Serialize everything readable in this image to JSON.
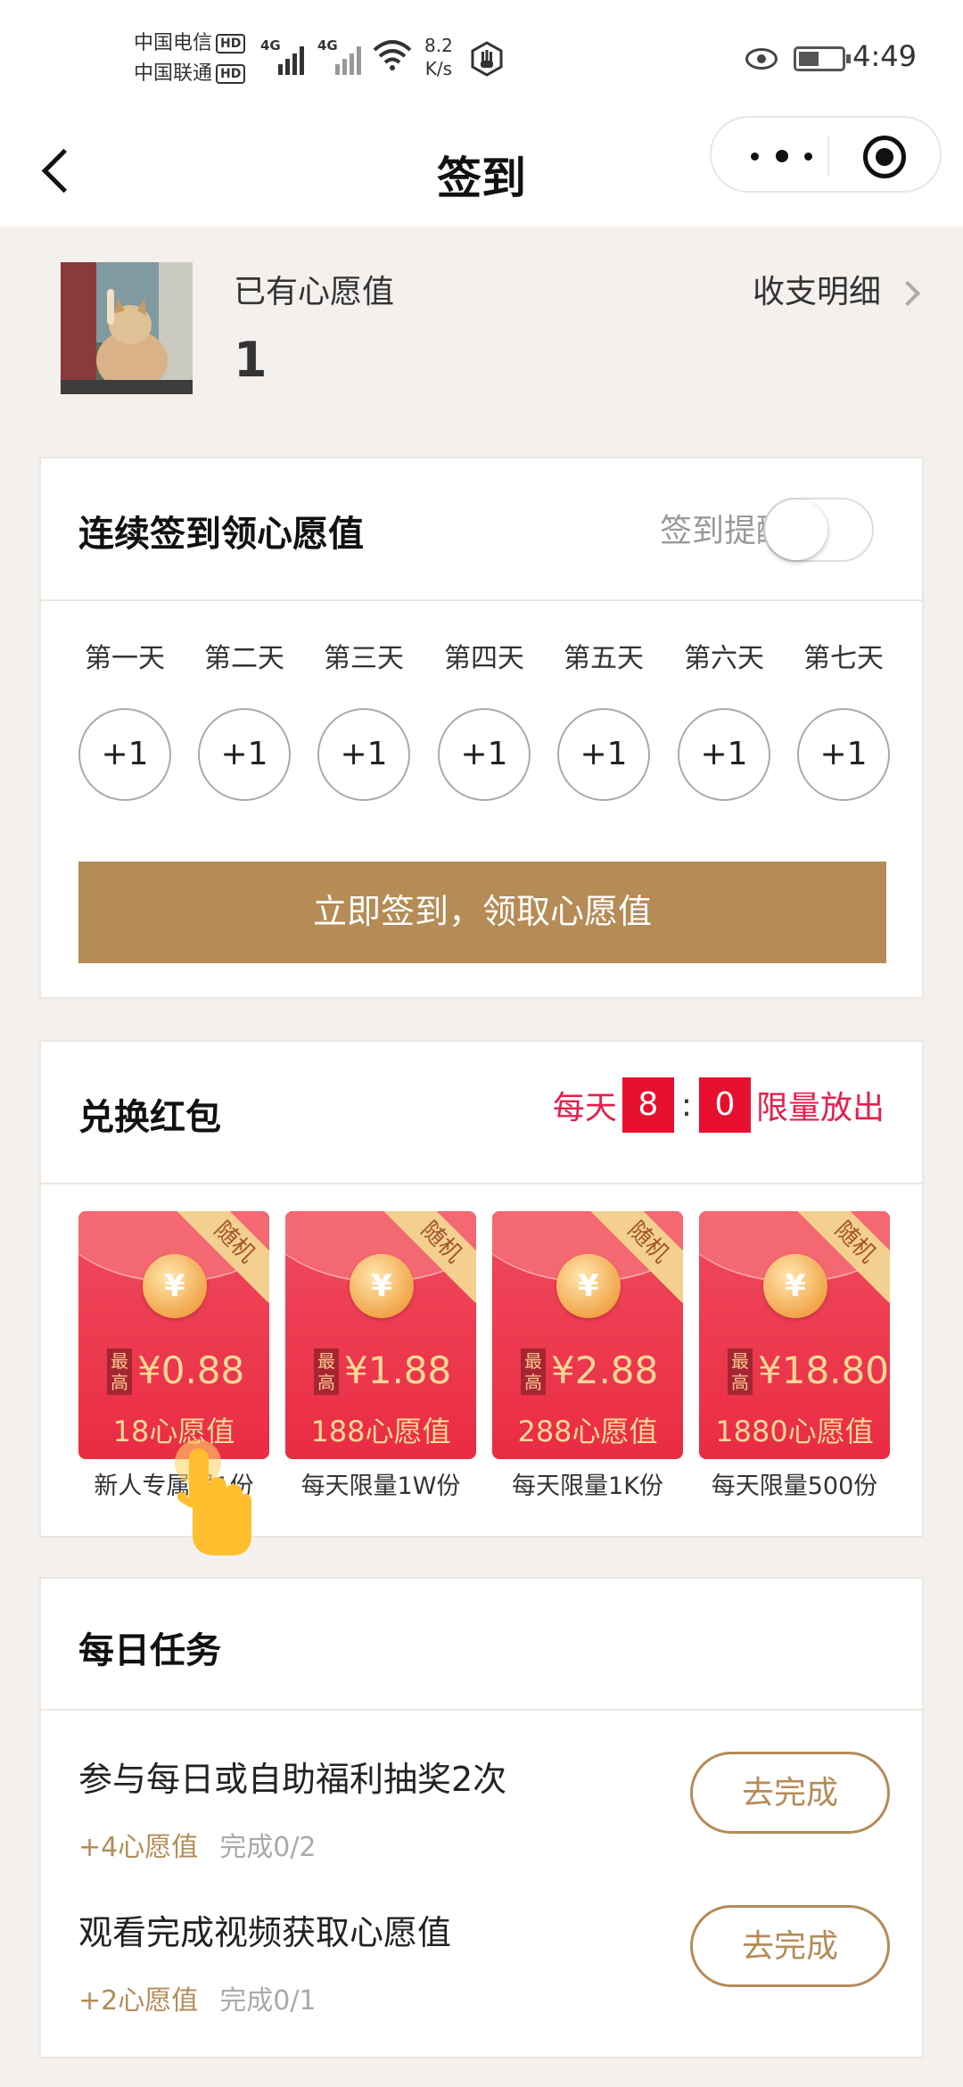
{
  "status_bar": {
    "carrier1": "中国电信",
    "carrier2": "中国联通",
    "hd": "HD",
    "net1": "4G",
    "net2": "4G",
    "speed_value": "8.2",
    "speed_unit": "K/s",
    "time": "4:49"
  },
  "nav": {
    "title": "签到"
  },
  "wish": {
    "label": "已有心愿值",
    "value": "1",
    "detail_link": "收支明细"
  },
  "signin": {
    "title": "连续签到领心愿值",
    "remind_label": "签到提醒",
    "remind_on": false,
    "days": [
      {
        "label": "第一天",
        "reward": "+1"
      },
      {
        "label": "第二天",
        "reward": "+1"
      },
      {
        "label": "第三天",
        "reward": "+1"
      },
      {
        "label": "第四天",
        "reward": "+1"
      },
      {
        "label": "第五天",
        "reward": "+1"
      },
      {
        "label": "第六天",
        "reward": "+1"
      },
      {
        "label": "第七天",
        "reward": "+1"
      }
    ],
    "button": "立即签到，领取心愿值"
  },
  "exchange": {
    "title": "兑换红包",
    "limit_prefix": "每天",
    "hour": "8",
    "colon": ":",
    "minute": "0",
    "limit_suffix": "限量放出",
    "packets": [
      {
        "tag": "随机",
        "coin": "¥",
        "max": "最高",
        "amount": "¥0.88",
        "cost": "18心愿值",
        "caption": "新人专属限1份"
      },
      {
        "tag": "随机",
        "coin": "¥",
        "max": "最高",
        "amount": "¥1.88",
        "cost": "188心愿值",
        "caption": "每天限量1W份"
      },
      {
        "tag": "随机",
        "coin": "¥",
        "max": "最高",
        "amount": "¥2.88",
        "cost": "288心愿值",
        "caption": "每天限量1K份"
      },
      {
        "tag": "随机",
        "coin": "¥",
        "max": "最高",
        "amount": "¥18.80",
        "cost": "1880心愿值",
        "caption": "每天限量500份"
      }
    ]
  },
  "tasks": {
    "title": "每日任务",
    "items": [
      {
        "title": "参与每日或自助福利抽奖2次",
        "reward": "+4心愿值",
        "progress": "完成0/2",
        "button": "去完成"
      },
      {
        "title": "观看完成视频获取心愿值",
        "reward": "+2心愿值",
        "progress": "完成0/1",
        "button": "去完成"
      }
    ]
  },
  "colors": {
    "accent": "#b58b56",
    "red": "#e8102f",
    "background": "#f3f0ee"
  }
}
